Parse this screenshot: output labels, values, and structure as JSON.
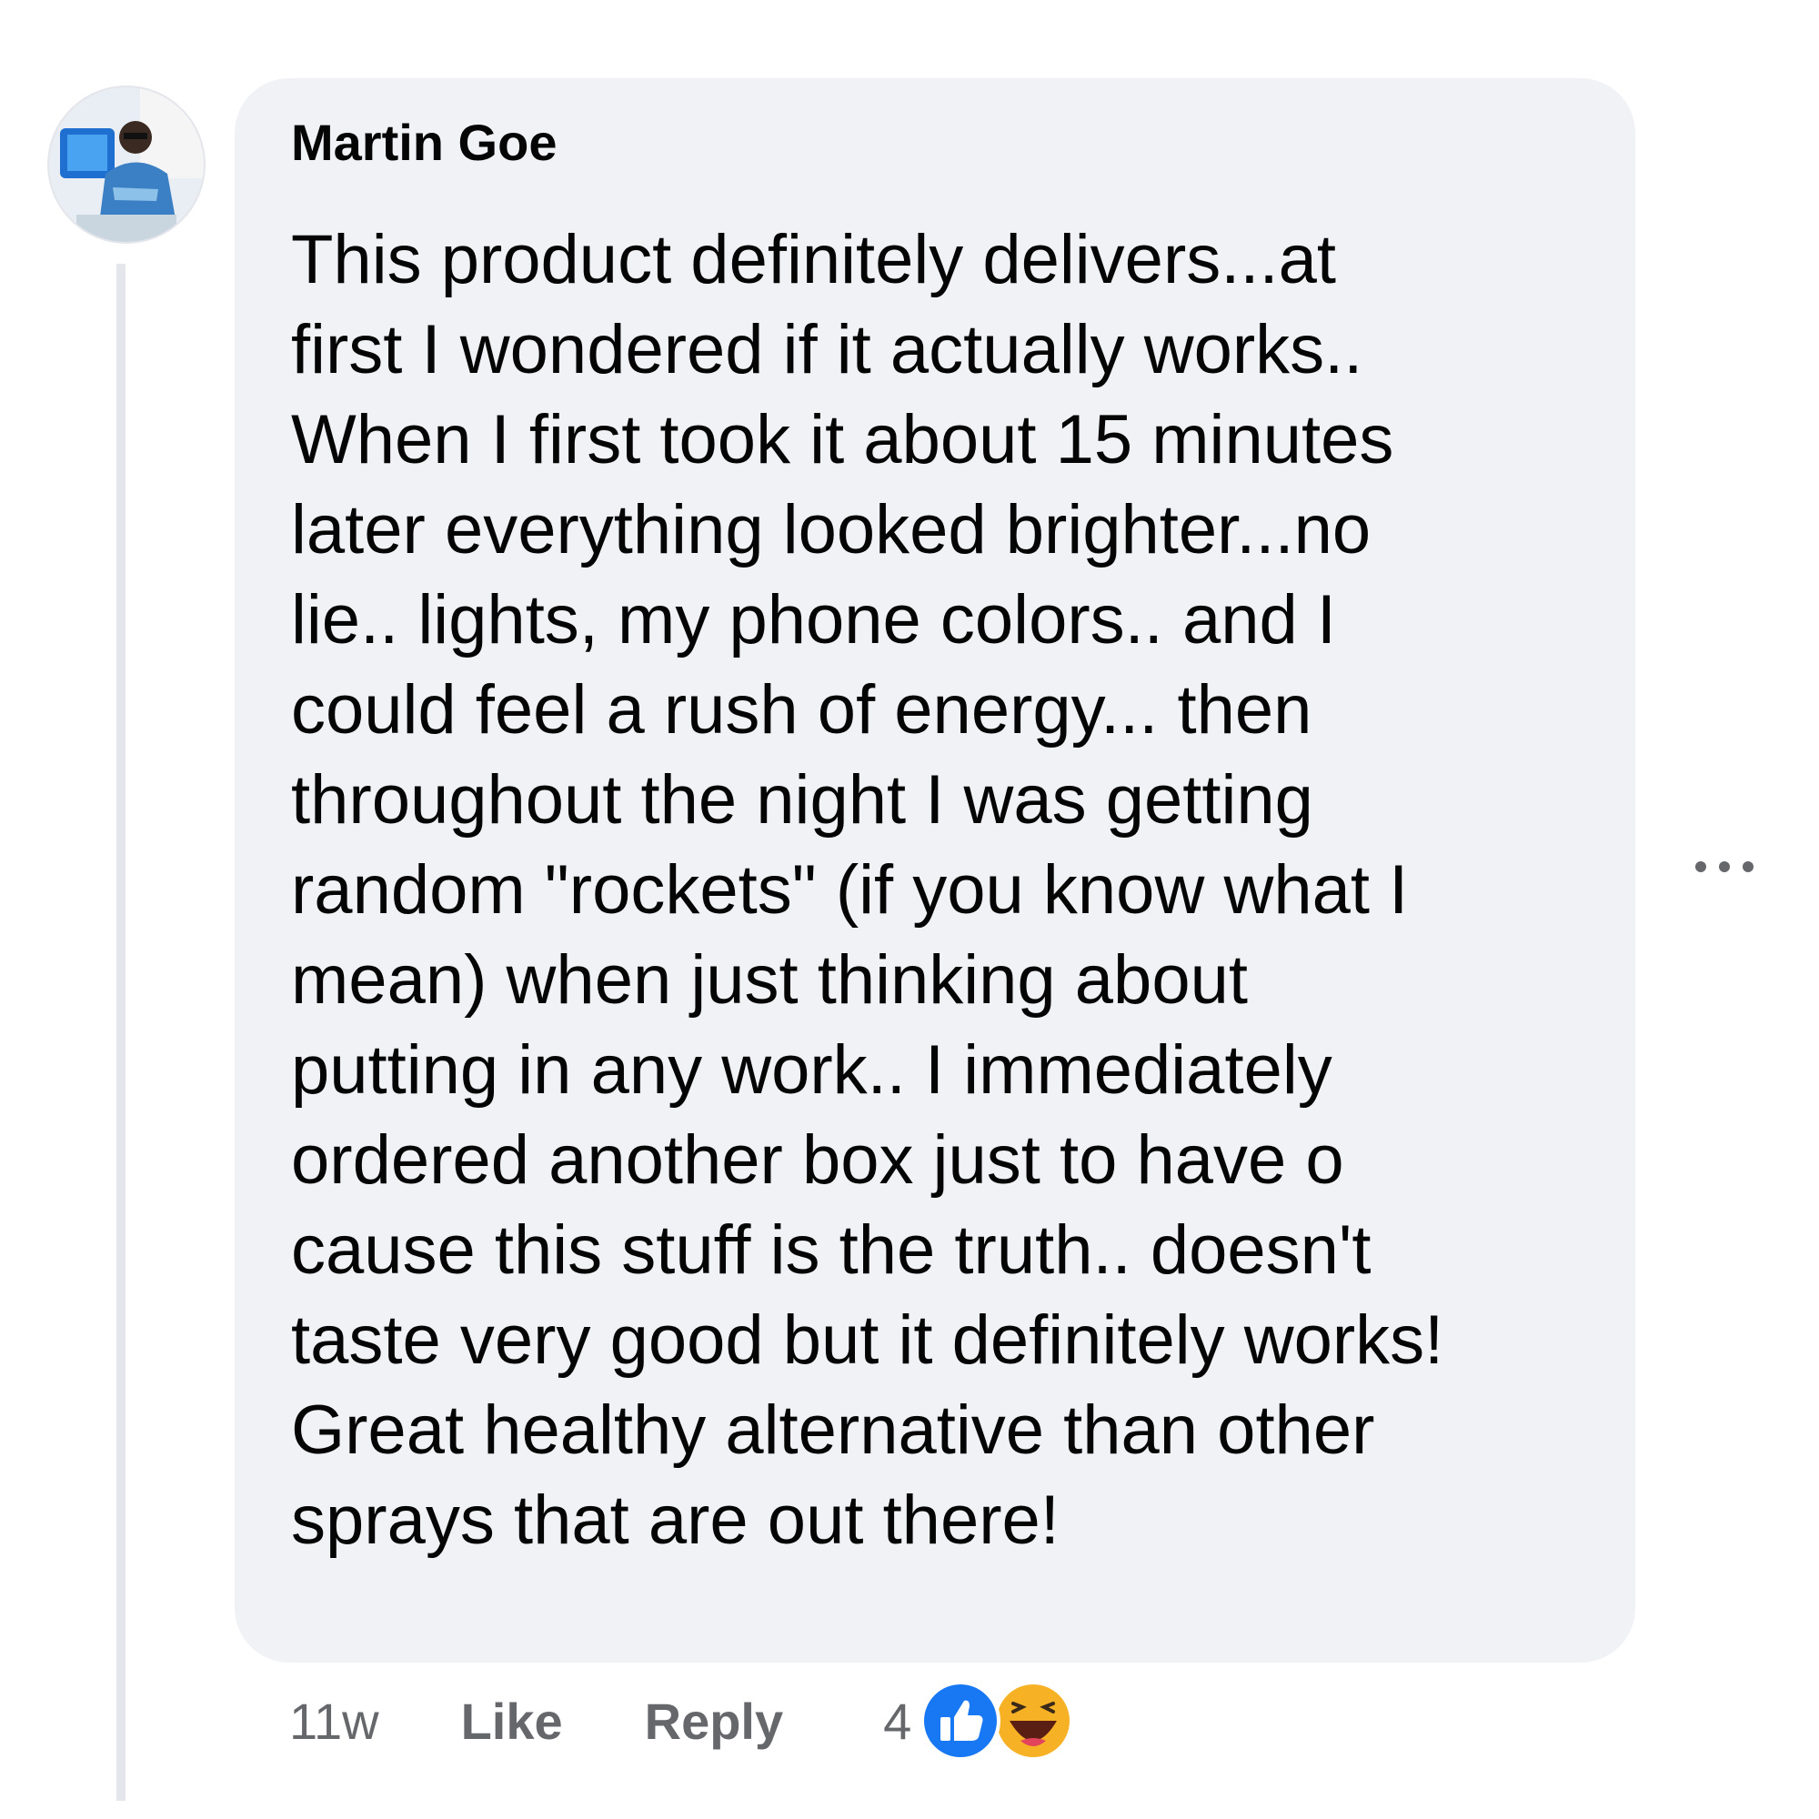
{
  "comment": {
    "author": "Martin Goe",
    "text_lines": [
      "This product definitely delivers...at",
      "first I wondered if it actually works..",
      "When I first took it about 15 minutes",
      "later everything looked brighter...no",
      "lie.. lights, my phone colors.. and I",
      "could feel a rush of energy... then",
      "throughout the night I was getting",
      "random \"rockets\" (if you know what I",
      "mean) when just thinking about",
      "putting in any work.. I immediately",
      "ordered another box just to have o",
      "cause this stuff is the truth.. doesn't",
      "taste very good but it definitely works!",
      "Great healthy alternative than other",
      "sprays that are out there!"
    ],
    "timestamp": "11w",
    "like_label": "Like",
    "reply_label": "Reply",
    "reaction_count": "4",
    "reactions": [
      "like-icon",
      "haha-icon"
    ]
  },
  "colors": {
    "bubble_bg": "#f0f2f5",
    "secondary_text": "#65676b",
    "like_blue": "#1877f2",
    "haha_yellow": "#f7b125"
  }
}
